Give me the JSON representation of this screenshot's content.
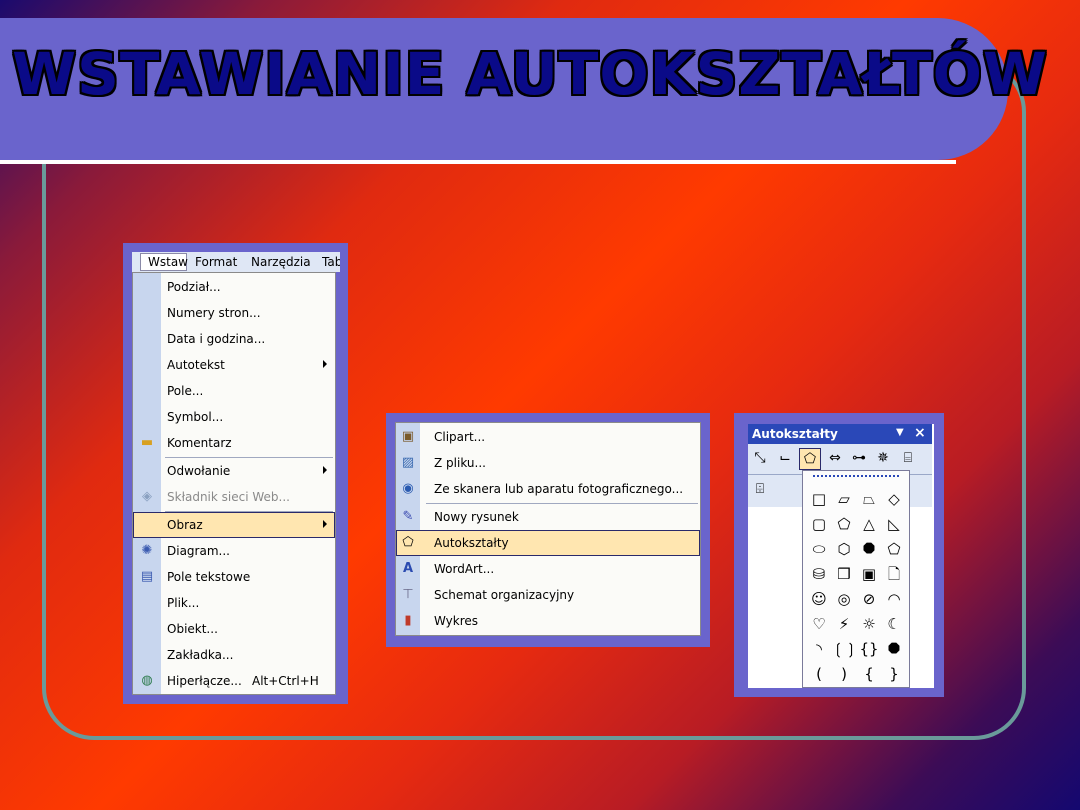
{
  "slide": {
    "title": "WSTAWIANIE AUTOKSZTAŁTÓW"
  },
  "colors": {
    "banner": "#6a64cc",
    "title_text": "#0a0a88",
    "frame": "#6a9a9a",
    "highlight": "#ffe6b0",
    "toolbar_title": "#2a48b8"
  },
  "insert_menu": {
    "menubar": [
      "Wstaw",
      "Format",
      "Narzędzia",
      "Tab"
    ],
    "items": [
      {
        "label": "Podział...",
        "icon": ""
      },
      {
        "label": "Numery stron...",
        "icon": ""
      },
      {
        "label": "Data i godzina...",
        "icon": ""
      },
      {
        "label": "Autotekst",
        "icon": "",
        "submenu": true
      },
      {
        "label": "Pole...",
        "icon": ""
      },
      {
        "label": "Symbol...",
        "icon": ""
      },
      {
        "label": "Komentarz",
        "icon": "comment-icon"
      },
      {
        "label": "Odwołanie",
        "icon": "",
        "submenu": true
      },
      {
        "label": "Składnik sieci Web...",
        "icon": "web-component-icon",
        "disabled": true
      },
      {
        "label": "Obraz",
        "icon": "",
        "submenu": true,
        "highlighted": true
      },
      {
        "label": "Diagram...",
        "icon": "diagram-icon"
      },
      {
        "label": "Pole tekstowe",
        "icon": "textbox-icon"
      },
      {
        "label": "Plik...",
        "icon": ""
      },
      {
        "label": "Obiekt...",
        "icon": ""
      },
      {
        "label": "Zakładka...",
        "icon": ""
      },
      {
        "label": "Hiperłącze...",
        "icon": "hyperlink-icon",
        "shortcut": "Alt+Ctrl+H"
      }
    ]
  },
  "picture_submenu": {
    "items": [
      {
        "label": "Clipart...",
        "icon": "clipart-icon"
      },
      {
        "label": "Z pliku...",
        "icon": "from-file-icon"
      },
      {
        "label": "Ze skanera lub aparatu fotograficznego...",
        "icon": "scanner-icon"
      },
      {
        "label": "Nowy rysunek",
        "icon": "new-drawing-icon"
      },
      {
        "label": "Autokształty",
        "icon": "autoshapes-icon",
        "highlighted": true
      },
      {
        "label": "WordArt...",
        "icon": "wordart-icon"
      },
      {
        "label": "Schemat organizacyjny",
        "icon": "org-chart-icon"
      },
      {
        "label": "Wykres",
        "icon": "chart-icon"
      }
    ]
  },
  "autoshapes_toolbar": {
    "title": "Autokształty",
    "buttons": [
      "lines-icon",
      "connectors-icon",
      "basic-shapes-icon",
      "block-arrows-icon",
      "flowchart-icon",
      "stars-banners-icon",
      "callouts-icon"
    ],
    "more_button": "more-autoshapes-icon",
    "shapes": [
      [
        "□",
        "▱",
        "⏢",
        "◇"
      ],
      [
        "▢",
        "⬠",
        "△",
        "◺"
      ],
      [
        "⬭",
        "⬡",
        "⯃",
        "⬠"
      ],
      [
        "⛁",
        "❒",
        "▣",
        "🗋"
      ],
      [
        "☺",
        "◎",
        "⊘",
        "◠"
      ],
      [
        "♡",
        "⚡",
        "☼",
        "☾"
      ],
      [
        "◝",
        "❲❳",
        "{}",
        "⯃"
      ],
      [
        "(",
        ")",
        "{",
        "}"
      ]
    ]
  }
}
